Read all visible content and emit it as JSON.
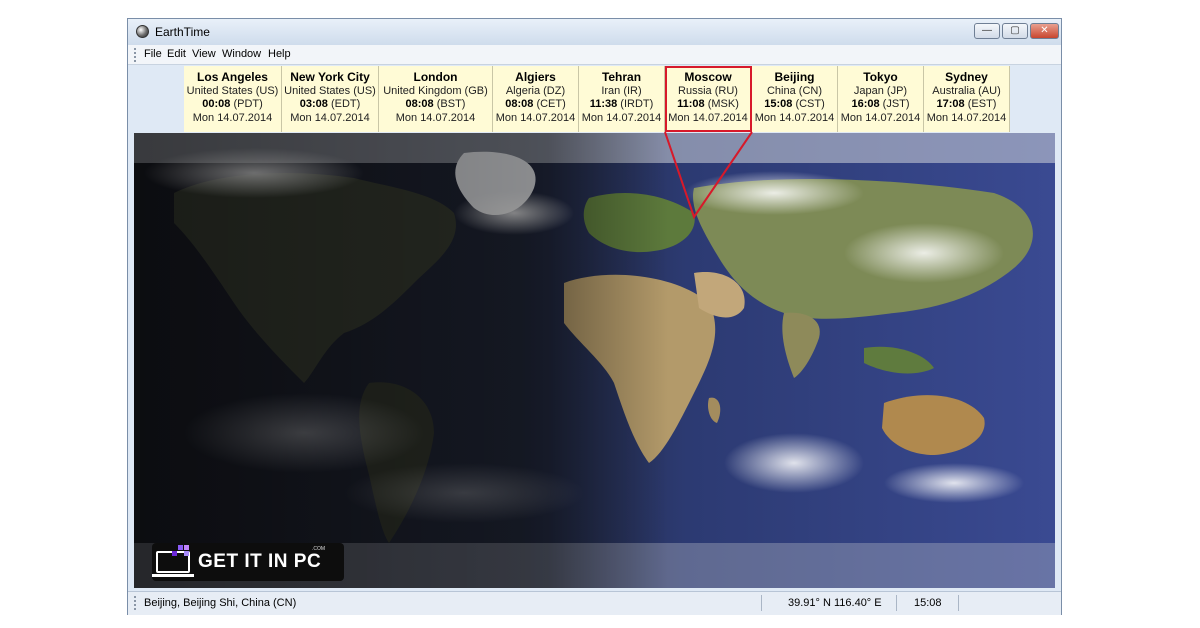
{
  "window": {
    "title": "EarthTime"
  },
  "menu": [
    "File",
    "Edit",
    "View",
    "Window",
    "Help"
  ],
  "controls": {
    "minimize": "—",
    "maximize": "▢",
    "close": "✕"
  },
  "cities": [
    {
      "name": "Los Angeles",
      "country": "United States (US)",
      "time": "00:08",
      "zone": "(PDT)",
      "date": "Mon 14.07.2014"
    },
    {
      "name": "New York City",
      "country": "United States (US)",
      "time": "03:08",
      "zone": "(EDT)",
      "date": "Mon 14.07.2014"
    },
    {
      "name": "London",
      "country": "United Kingdom (GB)",
      "time": "08:08",
      "zone": "(BST)",
      "date": "Mon 14.07.2014"
    },
    {
      "name": "Algiers",
      "country": "Algeria (DZ)",
      "time": "08:08",
      "zone": "(CET)",
      "date": "Mon 14.07.2014"
    },
    {
      "name": "Tehran",
      "country": "Iran (IR)",
      "time": "11:38",
      "zone": "(IRDT)",
      "date": "Mon 14.07.2014"
    },
    {
      "name": "Moscow",
      "country": "Russia (RU)",
      "time": "11:08",
      "zone": "(MSK)",
      "date": "Mon 14.07.2014",
      "selected": true
    },
    {
      "name": "Beijing",
      "country": "China (CN)",
      "time": "15:08",
      "zone": "(CST)",
      "date": "Mon 14.07.2014"
    },
    {
      "name": "Tokyo",
      "country": "Japan (JP)",
      "time": "16:08",
      "zone": "(JST)",
      "date": "Mon 14.07.2014"
    },
    {
      "name": "Sydney",
      "country": "Australia (AU)",
      "time": "17:08",
      "zone": "(EST)",
      "date": "Mon 14.07.2014"
    }
  ],
  "status": {
    "location": "Beijing, Beijing Shi, China (CN)",
    "coordinates": "39.91° N  116.40° E",
    "time": "15:08"
  },
  "watermark": {
    "text": "GET IT IN PC",
    "small": ".COM"
  },
  "colors": {
    "selection": "#d7192a",
    "clock_bg": "#fffbd6"
  }
}
